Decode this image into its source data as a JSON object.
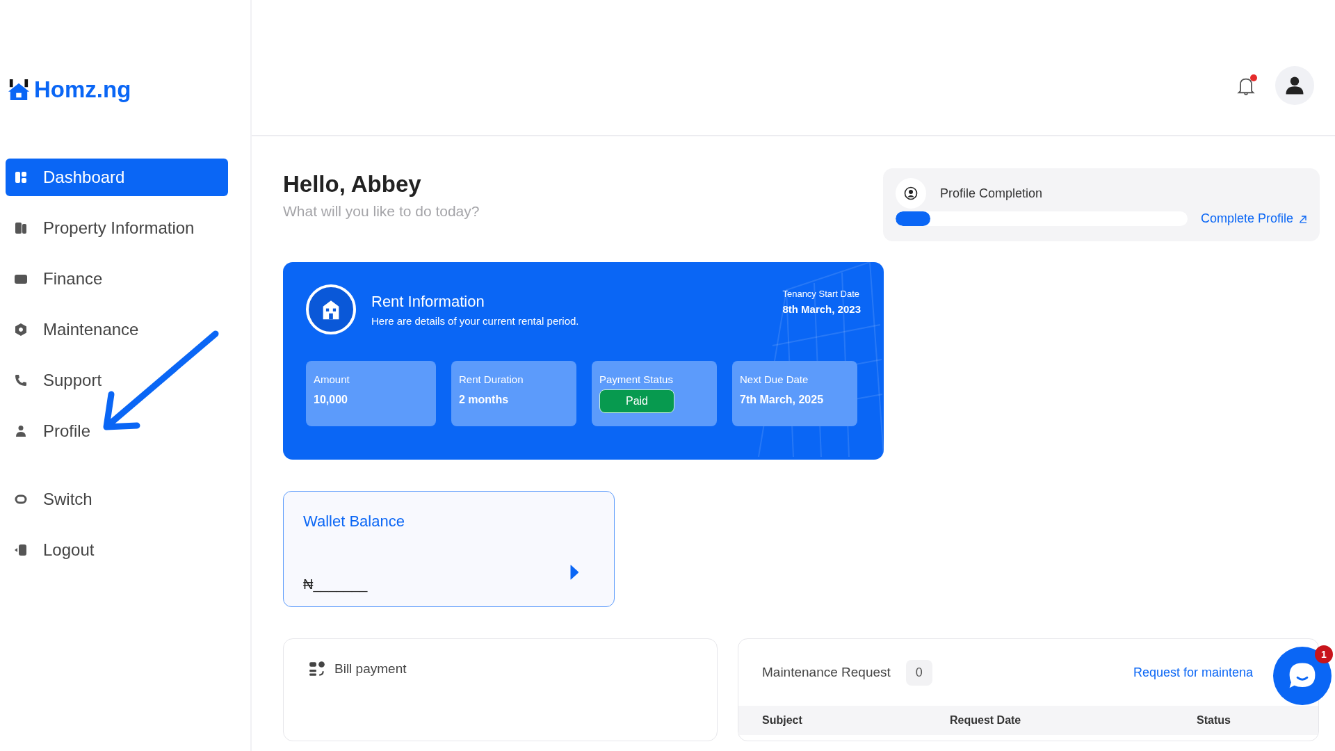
{
  "logo": {
    "text": "Homz.ng"
  },
  "header": {
    "notification_badge": true
  },
  "sidebar": {
    "items": [
      {
        "label": "Dashboard",
        "selected": true,
        "kind": "dashboard"
      },
      {
        "label": "Property Information",
        "selected": false,
        "kind": "property"
      },
      {
        "label": "Finance",
        "selected": false,
        "kind": "finance"
      },
      {
        "label": "Maintenance",
        "selected": false,
        "kind": "maintenance"
      },
      {
        "label": "Support",
        "selected": false,
        "kind": "support"
      },
      {
        "label": "Profile",
        "selected": false,
        "kind": "profile"
      }
    ],
    "bottom_items": [
      {
        "label": "Switch",
        "selected": false,
        "kind": "switch"
      },
      {
        "label": "Logout",
        "selected": false,
        "kind": "logout"
      }
    ]
  },
  "greeting": {
    "title": "Hello, Abbey",
    "subtitle": "What will you like to do today?"
  },
  "profile_completion": {
    "title": "Profile Completion",
    "level": 0.12,
    "link": "Complete Profile"
  },
  "rent_card": {
    "title": "Rent Information",
    "subtitle": "Here are details of your current rental period.",
    "start_label": "Tenancy Start Date",
    "start_value": "8th March, 2023",
    "stats": [
      {
        "label": "Amount",
        "value": "10,000",
        "kind": "text"
      },
      {
        "label": "Rent Duration",
        "value": "2 months",
        "kind": "text"
      },
      {
        "label": "Payment Status",
        "value": "Paid",
        "kind": "badge"
      },
      {
        "label": "Next Due Date",
        "value": "7th March, 2025",
        "kind": "text"
      }
    ]
  },
  "wallet": {
    "title": "Wallet Balance",
    "value": "₦_______"
  },
  "bill_payment": {
    "title": "Bill payment"
  },
  "maintenance": {
    "title": "Maintenance Request",
    "count": "0",
    "link": "Request for maintena",
    "columns": [
      "Subject",
      "Request Date",
      "Status"
    ]
  },
  "chat": {
    "badge": "1"
  }
}
